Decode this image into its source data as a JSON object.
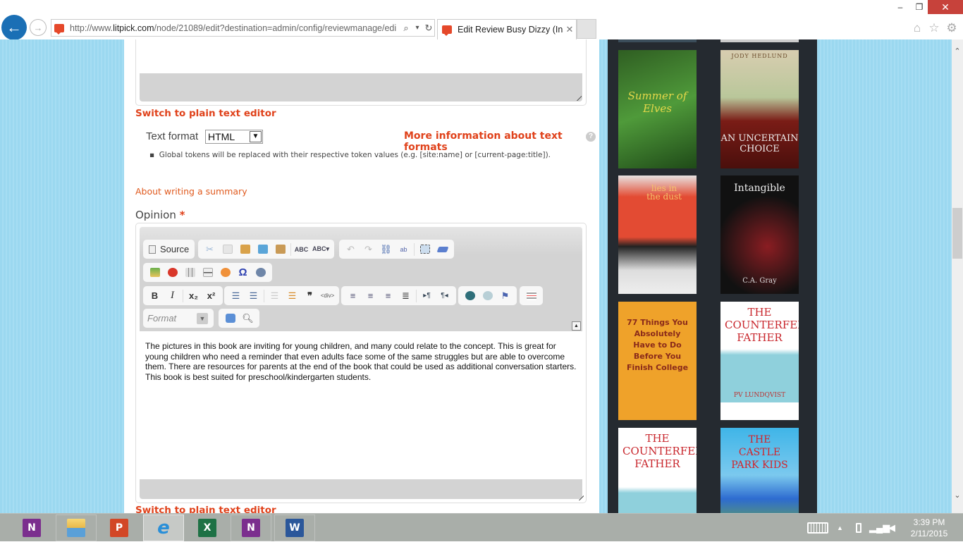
{
  "browser": {
    "url_prefix": "http://www.",
    "url_domain": "litpick.com",
    "url_path": "/node/21089/edit?destination=admin/config/reviewmanage/edi",
    "tab_title": "Edit Review Busy Dizzy (Ins...",
    "window_controls": {
      "minimize": "–",
      "maximize": "❐",
      "close": "✕"
    },
    "icons": {
      "back": "←",
      "forward": "→",
      "search": "⌕",
      "dropdown": "▾",
      "refresh": "↻",
      "home": "⌂",
      "favorites": "☆",
      "settings": "⚙",
      "tab_close": "✕"
    }
  },
  "form": {
    "switch_plain_text": "Switch to plain text editor",
    "text_format_label": "Text format",
    "text_format_value": "HTML",
    "more_info_link": "More information about text formats",
    "help_icon": "?",
    "tokens_note": "Global tokens will be replaced with their respective token values (e.g. [site:name] or [current-page:title]).",
    "about_summary_link": "About writing a summary",
    "opinion_label": "Opinion",
    "required_marker": "*",
    "opinion_text": "The pictures in this book are inviting for young children, and many could relate to the concept. This is great for young children who need a reminder that even adults face some of the same struggles but are able to overcome them. There are resources for parents at the end of the book that could be used as additional conversation starters. This book is best suited for preschool/kindergarten students."
  },
  "editor_toolbar": {
    "source_label": "Source",
    "format_placeholder": "Format",
    "bold": "B",
    "italic": "I",
    "subscript": "x₂",
    "superscript": "x²",
    "blockquote": "❞",
    "collapse": "▲"
  },
  "sidebar_books": [
    {
      "title": "Summer of Elves",
      "author": ""
    },
    {
      "title": "An Uncertain Choice",
      "author": "Jody Hedlund"
    },
    {
      "title": "lies in the dust",
      "author": ""
    },
    {
      "title": "Intangible",
      "author": "C.A. Gray"
    },
    {
      "title": "77 Things You Absolutely Have to Do Before You Finish College",
      "author": ""
    },
    {
      "title": "The Counterfeit Father",
      "author": "PV Lundqvist"
    },
    {
      "title": "The Counterfeit Father",
      "author": ""
    },
    {
      "title": "The Castle Park Kids",
      "author": ""
    }
  ],
  "scrollbar": {
    "up": "⌃",
    "down": "⌄"
  },
  "taskbar": {
    "apps": [
      {
        "name": "OneNote",
        "letter": "N",
        "color": "#7b2e8e"
      },
      {
        "name": "File Explorer",
        "letter": "",
        "color": "#f2c94c"
      },
      {
        "name": "PowerPoint",
        "letter": "P",
        "color": "#d24726"
      },
      {
        "name": "Internet Explorer",
        "letter": "e",
        "color": "#2a8fd8"
      },
      {
        "name": "Excel",
        "letter": "X",
        "color": "#1e7145"
      },
      {
        "name": "OneNote Clipper",
        "letter": "N",
        "color": "#7b2e8e"
      },
      {
        "name": "Word",
        "letter": "W",
        "color": "#2b579a"
      }
    ],
    "time": "3:39 PM",
    "date": "2/11/2015"
  }
}
